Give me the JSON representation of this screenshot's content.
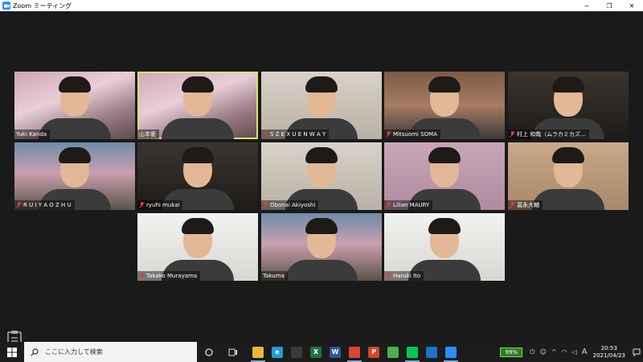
{
  "window": {
    "title": "Zoom ミーティング",
    "min_glyph": "─",
    "max_glyph": "❐",
    "close_glyph": "✕"
  },
  "participants": [
    {
      "name": "Yuki Kanda",
      "muted": false,
      "bg": "bg-blossom"
    },
    {
      "name": "山本衝",
      "muted": false,
      "bg": "bg-blossom",
      "active": true
    },
    {
      "name": "S Z E X U E N W A Y",
      "muted": true,
      "bg": "bg-room"
    },
    {
      "name": "Mitsuomi SOMA",
      "muted": true,
      "bg": "bg-brick"
    },
    {
      "name": "村上 和哉（ムラカミカズ…",
      "muted": true,
      "bg": "bg-dark"
    },
    {
      "name": "R U I Y A O Z H U",
      "muted": true,
      "bg": "bg-tree"
    },
    {
      "name": "ryuhi mukai",
      "muted": true,
      "bg": "bg-dark"
    },
    {
      "name": "Obonai Akiyoshi",
      "muted": true,
      "bg": "bg-room"
    },
    {
      "name": "Lilian MAURY",
      "muted": true,
      "bg": "bg-pink"
    },
    {
      "name": "冨永大輔",
      "muted": true,
      "bg": "bg-warm"
    },
    {
      "name": "Takako Murayama",
      "muted": true,
      "bg": "bg-white"
    },
    {
      "name": "Takuma",
      "muted": false,
      "bg": "bg-tree"
    },
    {
      "name": "Haruki Ito",
      "muted": true,
      "bg": "bg-white"
    }
  ],
  "taskbar": {
    "search_placeholder": "ここに入力して検索",
    "apps": [
      {
        "icon": "file-explorer-icon",
        "color": "#e8b830",
        "glyph": ""
      },
      {
        "icon": "edge-icon",
        "color": "#1f9bd6",
        "glyph": "e"
      },
      {
        "icon": "store-icon",
        "color": "#3a3a3a",
        "glyph": ""
      },
      {
        "icon": "excel-icon",
        "color": "#1e7145",
        "glyph": "X"
      },
      {
        "icon": "word-icon",
        "color": "#2b579a",
        "glyph": "W"
      },
      {
        "icon": "chrome-icon",
        "color": "#db4437",
        "glyph": ""
      },
      {
        "icon": "powerpoint-icon",
        "color": "#d24726",
        "glyph": "P"
      },
      {
        "icon": "chrome-icon",
        "color": "#4caf50",
        "glyph": ""
      },
      {
        "icon": "line-icon",
        "color": "#06c755",
        "glyph": ""
      },
      {
        "icon": "mail-icon",
        "color": "#1a73c9",
        "glyph": ""
      },
      {
        "icon": "zoom-icon",
        "color": "#2d8cff",
        "glyph": ""
      }
    ],
    "battery": "99%",
    "ime": "A",
    "time": "20:53",
    "date": "2021/04/23"
  }
}
